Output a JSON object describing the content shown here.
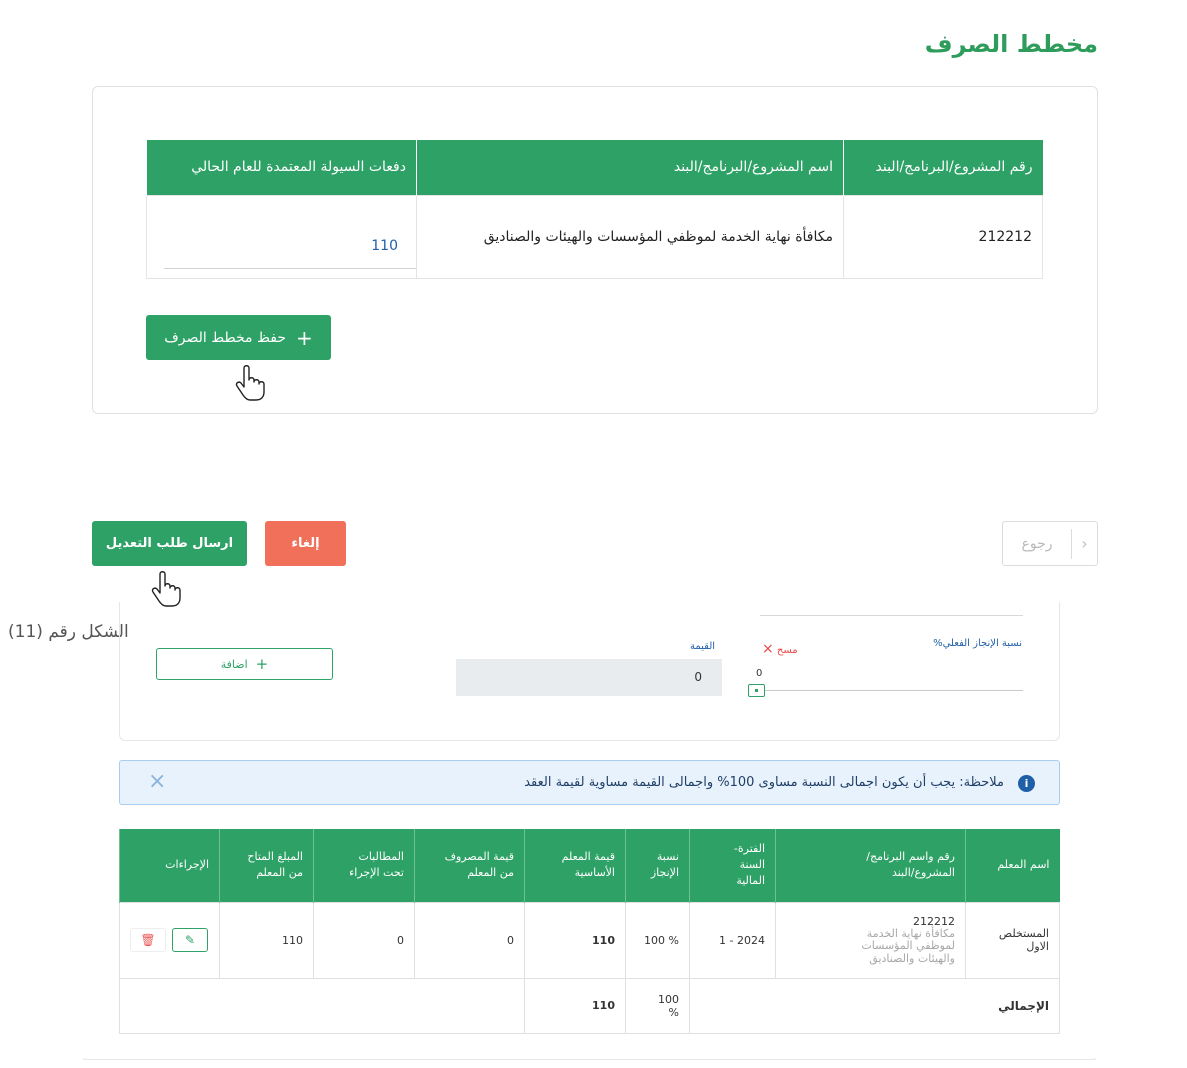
{
  "page": {
    "title": "مخطط الصرف"
  },
  "top_table": {
    "headers": {
      "number": "رقم المشروع/البرنامج/البند",
      "name": "اسم المشروع/البرنامج/البند",
      "liquidity": "دفعات السيولة المعتمدة للعام الحالي"
    },
    "row": {
      "number": "212212",
      "name": "مكافأة نهاية الخدمة لموظفي المؤسسات والهيئات والصناديق",
      "liquidity": "110"
    }
  },
  "save_button": {
    "label": "حفظ مخطط الصرف",
    "icon": "plus-icon"
  },
  "footer_actions": {
    "send_label": "ارسال طلب التعديل",
    "cancel_label": "إلغاء",
    "back_label": "رجوع",
    "back_icon": "chevron-right-icon"
  },
  "figure_caption": "الشكل رقم (11)",
  "form": {
    "achievement_label": "نسبة الإنجاز الفعلي%",
    "delete_label": "مسح",
    "value_label": "القيمة",
    "value": "0",
    "slider_value": "0",
    "add_label": "اضافة"
  },
  "note": {
    "text": "ملاحظة: يجب أن يكون اجمالى النسبة مساوى 100% واجمالى القيمة مساوية لقيمة العقد"
  },
  "bottom_table": {
    "headers": {
      "milestone": "اسم المعلم",
      "project_line1": "رقم واسم البرنامج/",
      "project_line2": "المشروع/البند",
      "period_line1": "الفترة-",
      "period_line2": "السنة",
      "period_line3": "المالية",
      "pct_line1": "نسبة",
      "pct_line2": "الإنجاز",
      "base_line1": "قيمة المعلم",
      "base_line2": "الأساسية",
      "spent_line1": "قيمة المصروف",
      "spent_line2": "من المعلم",
      "claims_line1": "المطالبات",
      "claims_line2": "تحت الإجراء",
      "available_line1": "المبلغ المتاح",
      "available_line2": "من المعلم",
      "actions": "الإجراءات"
    },
    "row": {
      "milestone_line1": "المستخلص",
      "milestone_line2": "الاول",
      "project_code": "212212",
      "project_name_line1": "مكافأة نهاية الخدمة",
      "project_name_line2": "لموظفي المؤسسات",
      "project_name_line3": "والهيئات والصناديق",
      "period": "2024 - 1",
      "percentage": "% 100",
      "base_value": "110",
      "spent": "0",
      "claims": "0",
      "available": "110"
    },
    "total": {
      "label": "الإجمالي",
      "percentage_line1": "100",
      "percentage_line2": "%",
      "base_value": "110"
    }
  },
  "colors": {
    "primary_green": "#2ea266",
    "cancel_red": "#f0705a",
    "info_blue": "#1f5fa8"
  }
}
